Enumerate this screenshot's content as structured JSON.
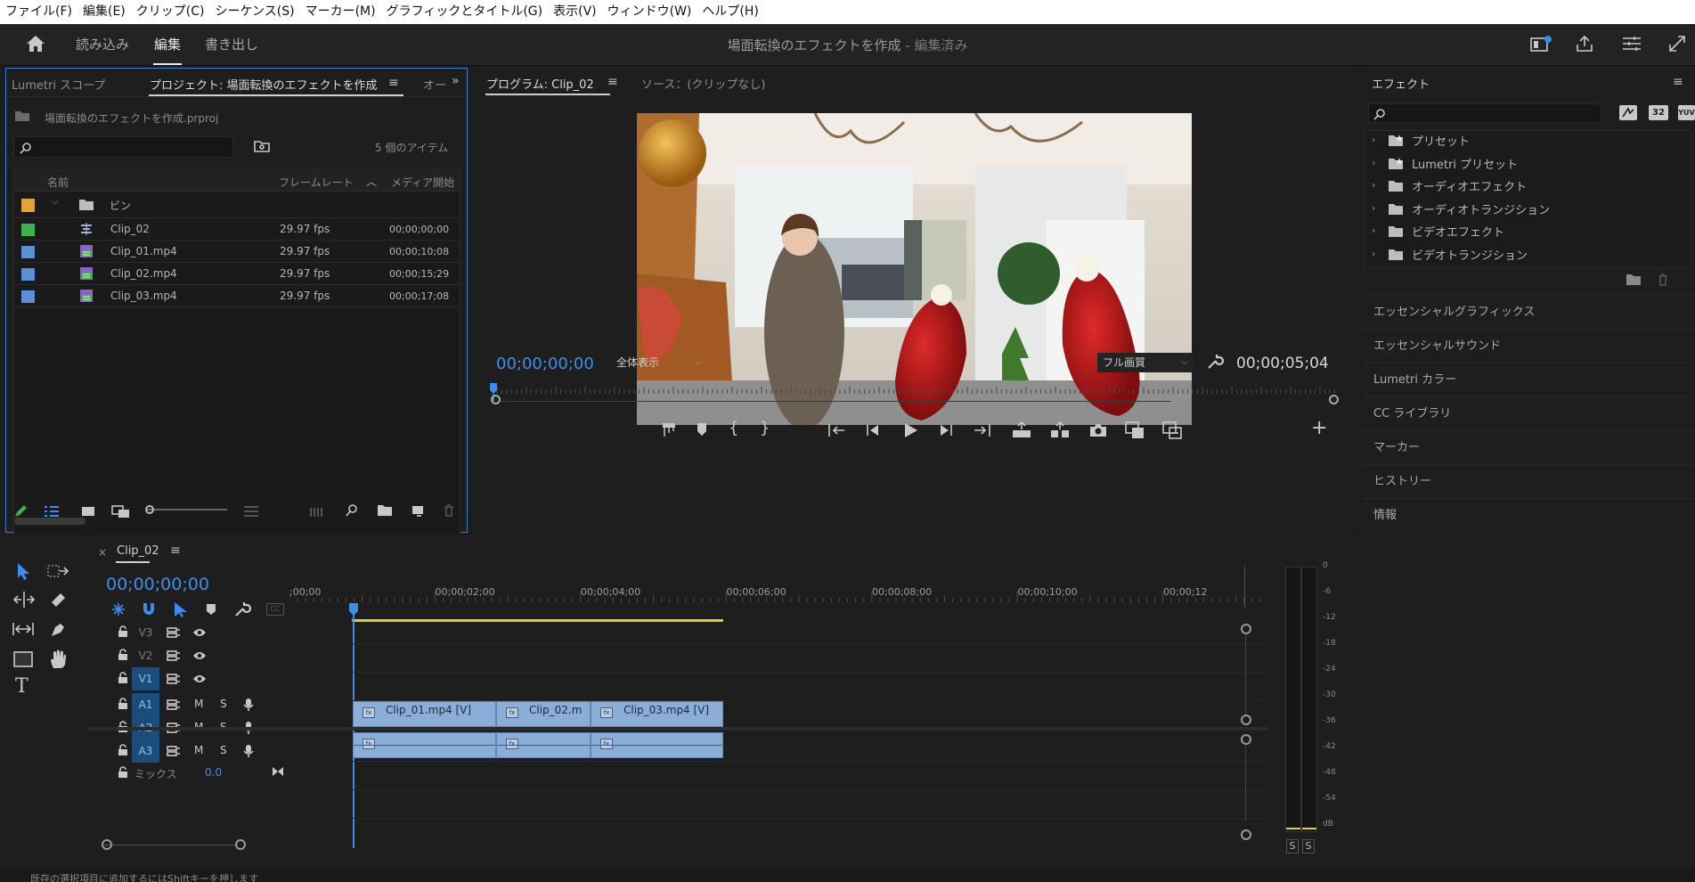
{
  "menu": [
    "ファイル(F)",
    "編集(E)",
    "クリップ(C)",
    "シーケンス(S)",
    "マーカー(M)",
    "グラフィックとタイトル(G)",
    "表示(V)",
    "ウィンドウ(W)",
    "ヘルプ(H)"
  ],
  "workspace": {
    "tabs": [
      "読み込み",
      "編集",
      "書き出し"
    ],
    "active_tab": "編集",
    "doc_title": "場面転換のエフェクトを作成",
    "doc_status": "- 編集済み"
  },
  "project_panel": {
    "tab_lumetri": "Lumetri スコープ",
    "tab_project": "プロジェクト: 場面転換のエフェクトを作成",
    "tab_more": "オー",
    "file_name": "場面転換のエフェクトを作成.prproj",
    "item_count": "5 個のアイテム",
    "columns": {
      "name": "名前",
      "frame_rate": "フレームレート",
      "media_start": "メディア開始"
    },
    "bin": "ビン",
    "items": [
      {
        "name": "Clip_02",
        "fps": "29.97 fps",
        "start": "00;00;00;00",
        "color": "#3db14a"
      },
      {
        "name": "Clip_01.mp4",
        "fps": "29.97 fps",
        "start": "00;00;10;08",
        "color": "#5b8fd6"
      },
      {
        "name": "Clip_02.mp4",
        "fps": "29.97 fps",
        "start": "00;00;15;29",
        "color": "#5b8fd6"
      },
      {
        "name": "Clip_03.mp4",
        "fps": "29.97 fps",
        "start": "00;00;17;08",
        "color": "#5b8fd6"
      }
    ],
    "bin_color": "#e8a133"
  },
  "program_monitor": {
    "tab_program": "プログラム: Clip_02",
    "tab_source": "ソース：(クリップなし)",
    "timecode": "00;00;00;00",
    "zoom": "全体表示",
    "quality": "フル画質",
    "duration": "00;00;05;04"
  },
  "effects_panel": {
    "title": "エフェクト",
    "folders": [
      "プリセット",
      "Lumetri プリセット",
      "オーディオエフェクト",
      "オーディオトランジション",
      "ビデオエフェクト",
      "ビデオトランジション"
    ],
    "buttons": [
      "32",
      "YUV"
    ],
    "sections": [
      "エッセンシャルグラフィックス",
      "エッセンシャルサウンド",
      "Lumetri カラー",
      "CC ライブラリ",
      "マーカー",
      "ヒストリー",
      "情報"
    ]
  },
  "timeline": {
    "sequence_tab": "Clip_02",
    "timecode": "00;00;00;00",
    "ruler": [
      ";00;00",
      "00;00;02;00",
      "00;00;04;00",
      "00;00;06;00",
      "00;00;08;00",
      "00;00;10;00",
      "00;00;12"
    ],
    "video_tracks": [
      "V3",
      "V2",
      "V1"
    ],
    "audio_tracks": [
      "A1",
      "A2",
      "A3"
    ],
    "mute": "M",
    "solo": "S",
    "mix_label": "ミックス",
    "mix_value": "0.0",
    "clips": [
      "Clip_01.mp4 [V]",
      "Clip_02.m",
      "Clip_03.mp4 [V]"
    ],
    "fx": "fx"
  },
  "meter": {
    "scale": [
      "0",
      "-6",
      "-12",
      "-18",
      "-24",
      "-30",
      "-36",
      "-42",
      "-48",
      "-54",
      "dB"
    ],
    "solo": [
      "S",
      "S"
    ]
  },
  "status_bar": "既存の選択項目に追加するにはShiftキーを押します",
  "colors": {
    "accent": "#3b8ef0",
    "clip": "#8aaed7",
    "work_area": "#e0cf2e"
  }
}
